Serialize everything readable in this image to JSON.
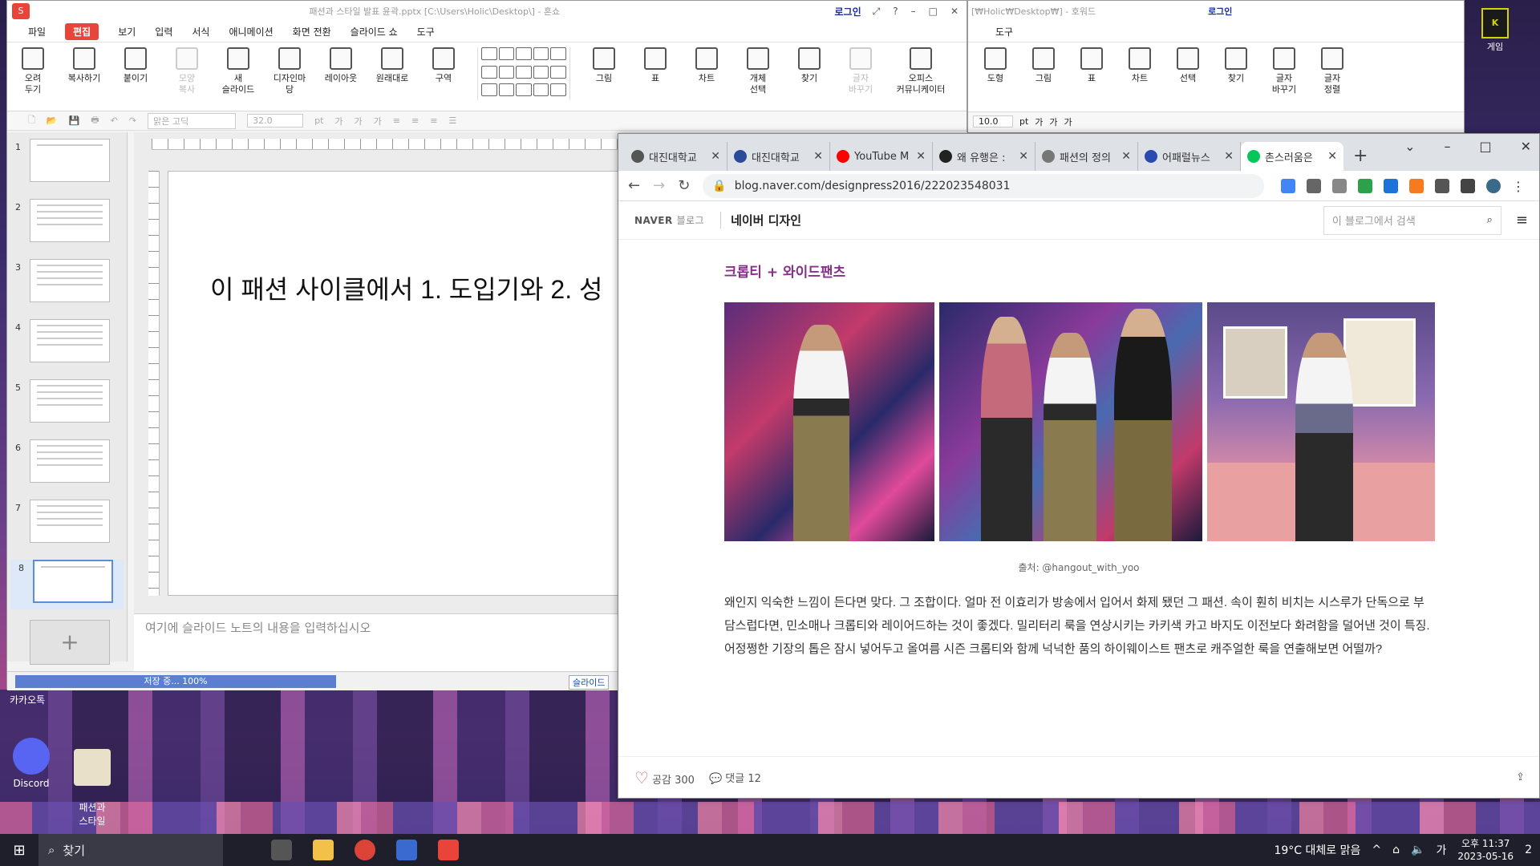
{
  "show": {
    "logo": "S",
    "title": "패션과 스타일 발표 윤곽.pptx [C:\\Users\\Holic\\Desktop\\] - 혼쇼",
    "login": "로그인",
    "menu": [
      "파일",
      "편집",
      "보기",
      "입력",
      "서식",
      "애니메이션",
      "화면 전환",
      "슬라이드 쇼",
      "도구"
    ],
    "ribbon": [
      {
        "label": "오려\n두기",
        "dim": false
      },
      {
        "label": "복사하기",
        "dim": false
      },
      {
        "label": "붙이기",
        "dim": false
      },
      {
        "label": "모양\n복사",
        "dim": true
      },
      {
        "label": "새\n슬라이드",
        "dim": false
      },
      {
        "label": "디자인마당",
        "dim": false
      },
      {
        "label": "레이아웃",
        "dim": false
      },
      {
        "label": "원래대로",
        "dim": false
      },
      {
        "label": "구역",
        "dim": false
      },
      {
        "label": "그림",
        "dim": false
      },
      {
        "label": "표",
        "dim": false
      },
      {
        "label": "차트",
        "dim": false
      },
      {
        "label": "개체\n선택",
        "dim": false
      },
      {
        "label": "찾기",
        "dim": false
      },
      {
        "label": "글자\n바꾸기",
        "dim": true
      },
      {
        "label": "오피스\n커뮤니케이터",
        "dim": false
      }
    ],
    "font_name": "맑은 고딕",
    "font_size": "32.0",
    "font_unit": "pt",
    "slide_numbers": [
      "1",
      "2",
      "3",
      "4",
      "5",
      "6",
      "7",
      "8"
    ],
    "slide_text": "이 패션 사이클에서 1. 도입기와 2. 성",
    "notes_placeholder": "여기에 슬라이드 노트의 내용을 입력하십시오",
    "progress_text": "저장 중... 100%",
    "progress_fraction": 1.0,
    "slides_tab": "슬라이드"
  },
  "hwp": {
    "title": "[₩Holic₩Desktop₩] - 호워드",
    "login": "로그인",
    "menu": [
      "도구"
    ],
    "ribbon": [
      "도형",
      "그림",
      "표",
      "차트",
      "선택",
      "찾기",
      "글자\n바꾸기",
      "글자\n정렬"
    ],
    "font_size": "10.0",
    "font_unit": "pt"
  },
  "game_icon": {
    "label": "게임"
  },
  "chrome": {
    "tabs": [
      {
        "label": "대진대학교",
        "color": "#555555"
      },
      {
        "label": "대진대학교",
        "color": "#2a4a9a"
      },
      {
        "label": "YouTube M",
        "color": "#ff0000"
      },
      {
        "label": "왜 유행은 :",
        "color": "#222222"
      },
      {
        "label": "패션의 정의",
        "color": "#777777"
      },
      {
        "label": "어패럴뉴스",
        "color": "#2a4ab0"
      },
      {
        "label": "촌스러움은",
        "color": "#03c75a"
      }
    ],
    "url": "blog.naver.com/designpress2016/222023548031"
  },
  "blog": {
    "naver_logo": "NAVER",
    "naver_blog": "블로그",
    "blog_name": "네이버 디자인",
    "search_placeholder": "이 블로그에서 검색",
    "heading": "크롭티 + 와이드팬츠",
    "caption": "출처: @hangout_with_yoo",
    "body": "왜인지 익숙한 느낌이 든다면 맞다. 그 조합이다. 얼마 전 이효리가 방송에서 입어서 화제 됐던 그 패션. 속이 훤히 비치는 시스루가 단독으로 부담스럽다면, 민소매나 크롭티와 레이어드하는 것이 좋겠다. 밀리터리 룩을 연상시키는 카키색 카고 바지도 이전보다 화려함을 덜어낸 것이 특징. 어정쩡한 기장의 톱은 잠시 넣어두고 올여름 시즌 크롭티와 함께 넉넉한 품의 하이웨이스트 팬츠로 캐주얼한 룩을 연출해보면 어떨까?",
    "like_label": "공감 300",
    "comment_label": "댓글 12"
  },
  "desktop": {
    "kakao_label": "카카오톡",
    "icons": [
      {
        "label": "Discord"
      },
      {
        "label": "패션과\n스타일"
      }
    ]
  },
  "taskbar": {
    "search_label": "찾기",
    "weather": "19°C  대체로 맑음",
    "time": "오후 11:37",
    "date": "2023-05-16",
    "notif_count": "2"
  }
}
